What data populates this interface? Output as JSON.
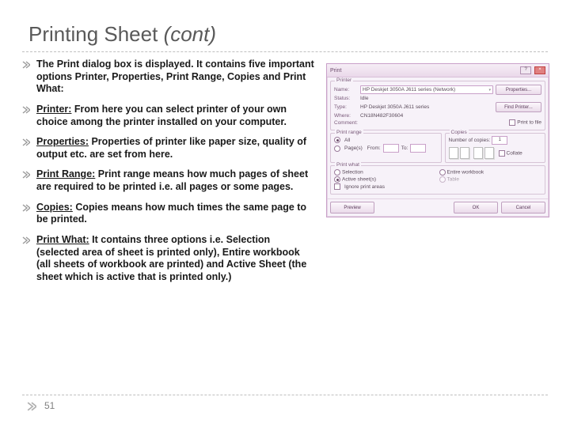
{
  "title": {
    "main": "Printing Sheet ",
    "italic": "(cont)"
  },
  "bullets": [
    {
      "lead": "",
      "text": "The Print dialog box is displayed. It contains five important options Printer, Properties, Print Range, Copies and Print What:"
    },
    {
      "lead": "Printer:",
      "text": " From here you can select printer of your own choice among the printer installed on your computer."
    },
    {
      "lead": "Properties:",
      "text": " Properties of printer like paper size, quality of output etc. are set from here."
    },
    {
      "lead": "Print Range:",
      "text": " Print range means how much pages of sheet are required to be printed i.e. all pages or some pages."
    },
    {
      "lead": "Copies:",
      "text": " Copies means how much times the same page to be printed."
    },
    {
      "lead": "Print What:",
      "text": " It contains three options i.e. Selection (selected area of sheet is printed only), Entire workbook (all sheets of workbook are printed) and Active Sheet (the sheet which is active that is printed only.)"
    }
  ],
  "dialog": {
    "title": "Print",
    "printer": {
      "legend": "Printer",
      "name_label": "Name:",
      "name_value": "HP Deskjet 3050A J611 series (Network)",
      "status_label": "Status:",
      "status_value": "Idle",
      "type_label": "Type:",
      "type_value": "HP Deskjet 3050A J611 series",
      "where_label": "Where:",
      "where_value": "CN18N482F30604",
      "comment_label": "Comment:",
      "properties_btn": "Properties...",
      "find_btn": "Find Printer...",
      "print_to_file": "Print to file"
    },
    "range": {
      "legend": "Print range",
      "all": "All",
      "pages": "Page(s)",
      "from": "From:",
      "to": "To:"
    },
    "copies": {
      "legend": "Copies",
      "num_label": "Number of copies:",
      "num_value": "1",
      "collate": "Collate"
    },
    "what": {
      "legend": "Print what",
      "selection": "Selection",
      "active": "Active sheet(s)",
      "workbook": "Entire workbook",
      "table": "Table",
      "ignore": "Ignore print areas"
    },
    "footer": {
      "preview": "Preview",
      "ok": "OK",
      "cancel": "Cancel"
    }
  },
  "page_number": "51"
}
